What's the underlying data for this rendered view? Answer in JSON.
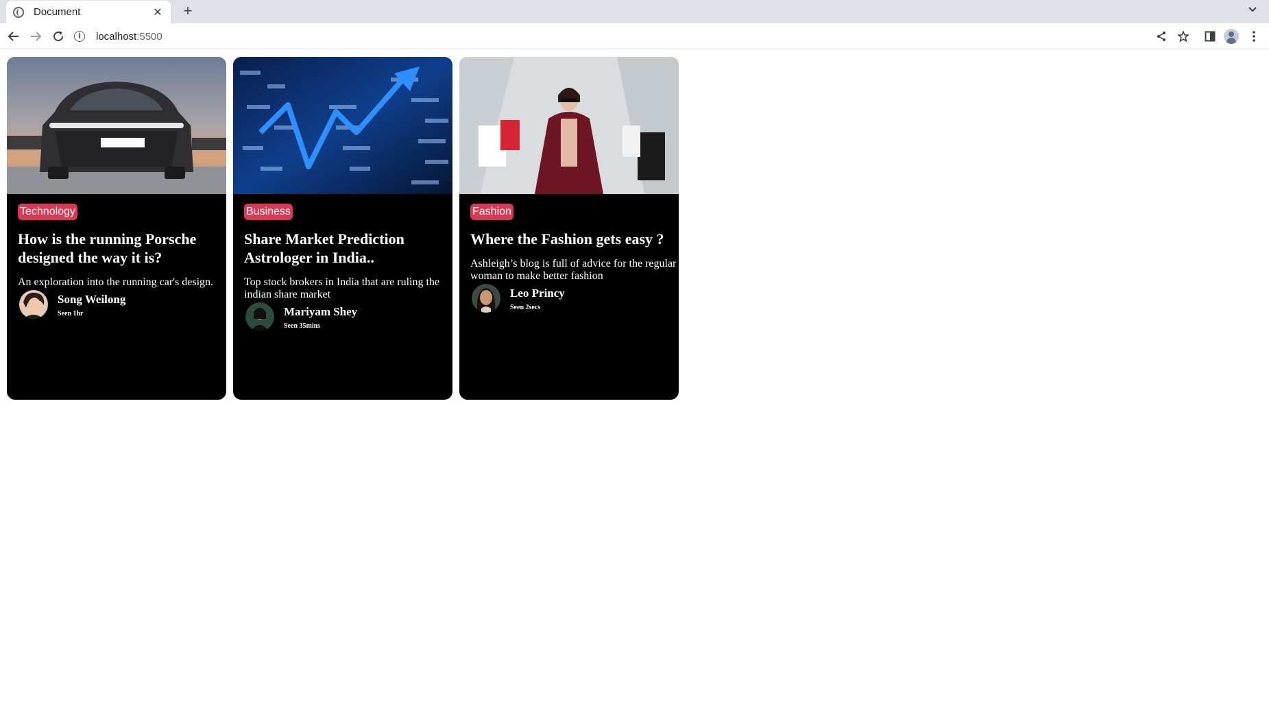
{
  "browser": {
    "tab_title": "Document",
    "tab_close": "✕",
    "new_tab": "+",
    "url_host": "localhost",
    "url_port": ":5500",
    "icons": [
      "globe-icon",
      "close-icon",
      "plus-icon",
      "chevron-down-icon",
      "back-arrow-icon",
      "forward-arrow-icon",
      "reload-icon",
      "info-icon",
      "share-icon",
      "star-icon",
      "side-panel-icon",
      "profile-icon",
      "kebab-menu-icon"
    ]
  },
  "cards": [
    {
      "image": "car-photo",
      "tag": "Technology",
      "title": "How is the running Porsche designed the way it is?",
      "description": "An exploration into the running car's design.",
      "author": {
        "name": "Song Weilong",
        "seen": "Seen 1hr"
      }
    },
    {
      "image": "stock-chart-photo",
      "tag": "Business",
      "title": "Share Market Prediction Astrologer in India..",
      "description": "Top stock brokers in India that are ruling the indian share market",
      "author": {
        "name": "Mariyam Shey",
        "seen": "Seen 35mins"
      }
    },
    {
      "image": "shopping-woman-photo",
      "tag": "Fashion",
      "title": "Where the Fashion gets easy ?",
      "description": "Ashleigh’s blog is full of advice for the regular woman to make better fashion",
      "author": {
        "name": "Leo Princy",
        "seen": "Seen 2secs"
      }
    }
  ],
  "colors": {
    "tag_bg": "#d83a56",
    "card_bg": "#000000",
    "chrome_bg": "#dee1e6"
  }
}
